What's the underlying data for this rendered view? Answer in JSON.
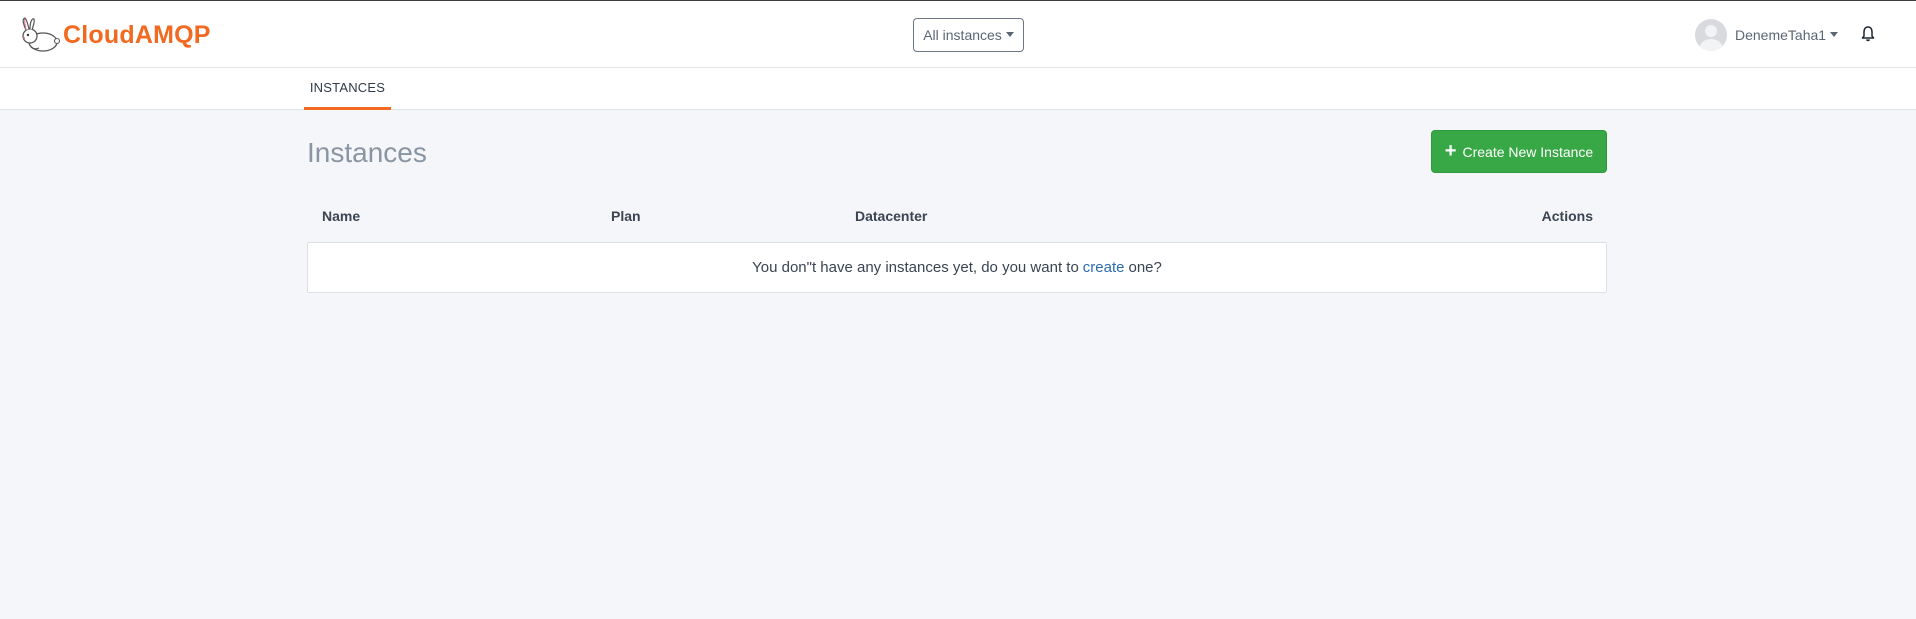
{
  "brand": {
    "name": "CloudAMQP",
    "color": "#f26a21",
    "logo_icon": "rabbit-logo-icon"
  },
  "header": {
    "instance_selector": {
      "value": "All instances"
    },
    "user": {
      "name": "DenemeTaha1"
    },
    "notifications_icon": "bell-icon"
  },
  "subnav": {
    "tabs": [
      {
        "label": "INSTANCES",
        "active": true
      }
    ]
  },
  "main": {
    "title": "Instances",
    "create_button": {
      "label": "Create New Instance",
      "icon": "plus-icon",
      "color": "#38a745"
    },
    "table": {
      "columns": [
        "Name",
        "Plan",
        "Datacenter",
        "Actions"
      ],
      "empty_message": {
        "before": "You don\"t have any instances yet, do you want to",
        "link": "create",
        "after": "one?"
      }
    }
  }
}
